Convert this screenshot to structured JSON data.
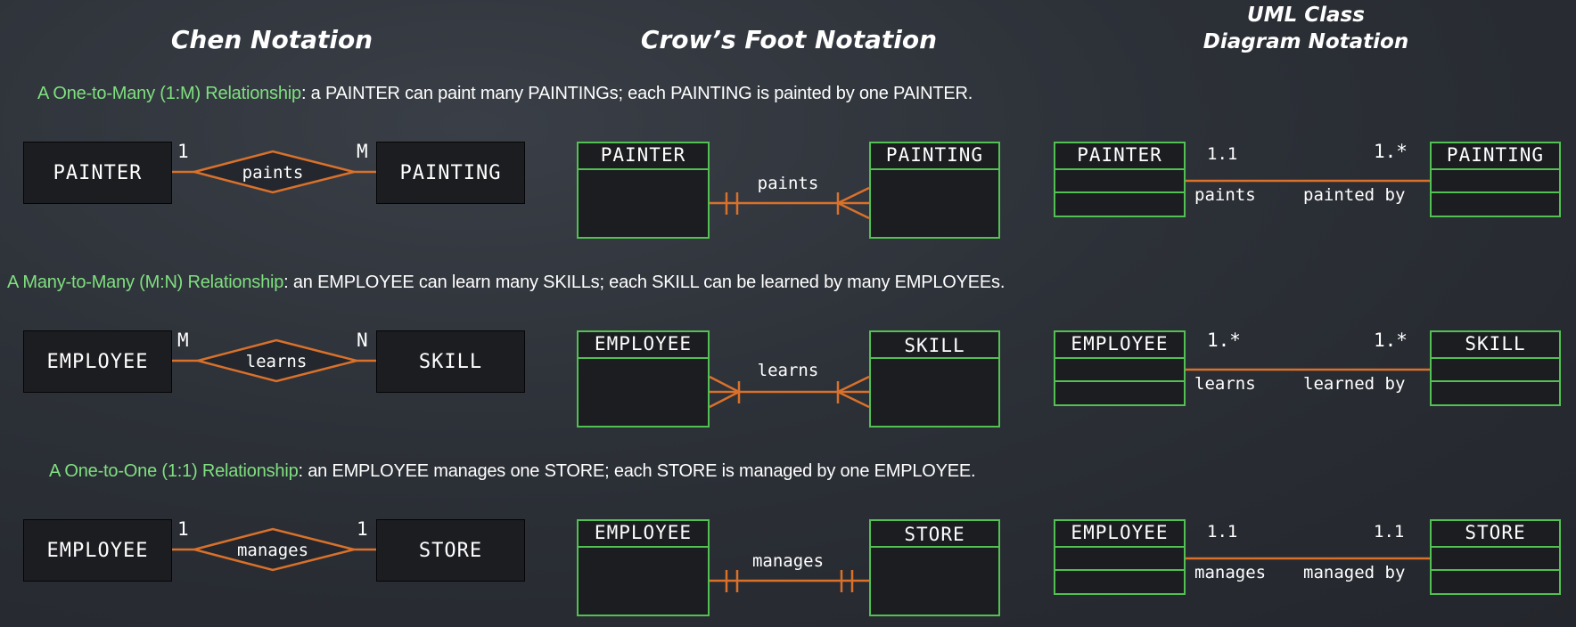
{
  "columns": {
    "chen": "Chen Notation",
    "crow": "Crow’s Foot Notation",
    "uml_line1": "UML Class",
    "uml_line2": "Diagram Notation"
  },
  "relationships": [
    {
      "highlight": "A One-to-Many (1:M) Relationship",
      "description": ": a PAINTER can paint many PAINTINGs; each PAINTING is painted by one PAINTER.",
      "left_entity": "PAINTER",
      "right_entity": "PAINTING",
      "verb": "paints",
      "reverse_verb": "painted by",
      "chen_left_card": "1",
      "chen_right_card": "M",
      "uml_left_mult": "1.1",
      "uml_right_mult": "1.*"
    },
    {
      "highlight": "A Many-to-Many (M:N) Relationship",
      "description": ": an EMPLOYEE can learn many SKILLs; each SKILL can be learned by many EMPLOYEEs.",
      "left_entity": "EMPLOYEE",
      "right_entity": "SKILL",
      "verb": "learns",
      "reverse_verb": "learned by",
      "chen_left_card": "M",
      "chen_right_card": "N",
      "uml_left_mult": "1.*",
      "uml_right_mult": "1.*"
    },
    {
      "highlight": "A One-to-One (1:1) Relationship",
      "description": ": an EMPLOYEE manages one STORE; each STORE is managed by one EMPLOYEE.",
      "left_entity": "EMPLOYEE",
      "right_entity": "STORE",
      "verb": "manages",
      "reverse_verb": "managed by",
      "chen_left_card": "1",
      "chen_right_card": "1",
      "uml_left_mult": "1.1",
      "uml_right_mult": "1.1"
    }
  ],
  "colors": {
    "background": "#2c3037",
    "highlight_green": "#7fe07f",
    "box_border_green": "#52c052",
    "line_orange": "#d9712b",
    "entity_fill": "#1c1d21"
  }
}
